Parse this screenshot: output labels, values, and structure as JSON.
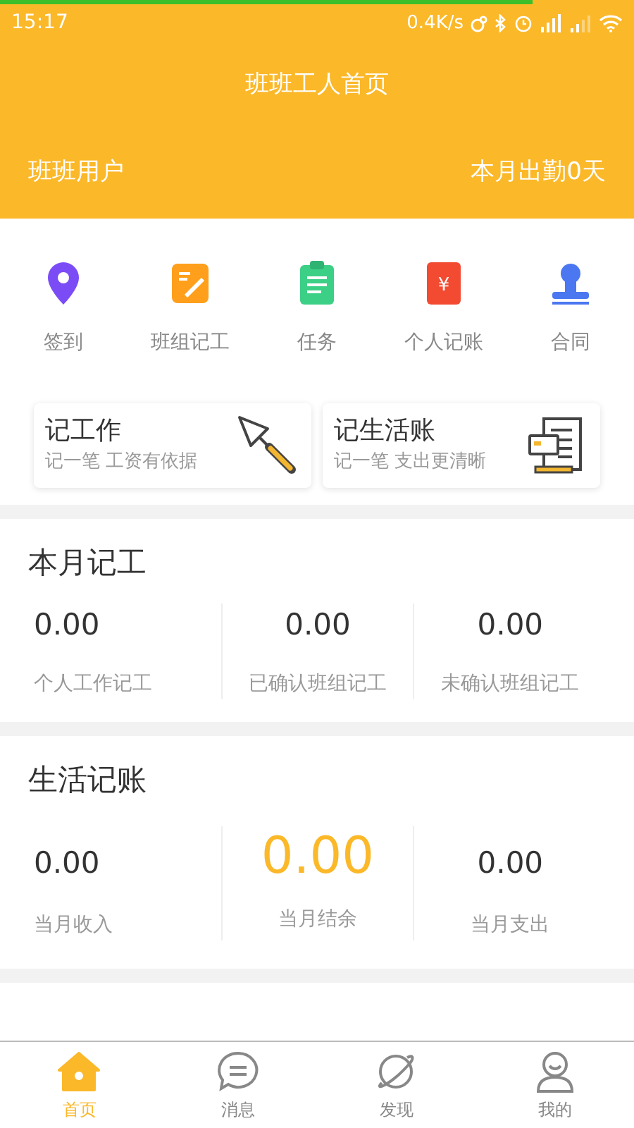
{
  "status_bar": {
    "time": "15:17",
    "speed": "0.4K/s",
    "load_bar": {
      "level": 0.84
    }
  },
  "header": {
    "title": "班班工人首页",
    "user": "班班用户",
    "attendance": "本月出勤0天"
  },
  "shortcuts": [
    {
      "kind": "pin",
      "label": "签到"
    },
    {
      "kind": "note",
      "label": "班组记工"
    },
    {
      "kind": "clipboard",
      "label": "任务"
    },
    {
      "kind": "ledger",
      "label": "个人记账",
      "glyph": "¥"
    },
    {
      "kind": "stamp",
      "label": "合同"
    }
  ],
  "cards": [
    {
      "kind": "trowel",
      "title": "记工作",
      "subtitle": "记一笔 工资有依据"
    },
    {
      "kind": "receipt",
      "title": "记生活账",
      "subtitle": "记一笔 支出更清晰"
    }
  ],
  "work_section": {
    "title": "本月记工",
    "stats": [
      {
        "value": "0.00",
        "label": "个人工作记工",
        "highlight": false
      },
      {
        "value": "0.00",
        "label": "已确认班组记工",
        "highlight": false
      },
      {
        "value": "0.00",
        "label": "未确认班组记工",
        "highlight": false
      }
    ]
  },
  "life_section": {
    "title": "生活记账",
    "stats": [
      {
        "value": "0.00",
        "label": "当月收入",
        "highlight": false
      },
      {
        "value": "0.00",
        "label": "当月结余",
        "highlight": true
      },
      {
        "value": "0.00",
        "label": "当月支出",
        "highlight": false
      }
    ]
  },
  "nav": [
    {
      "kind": "home",
      "label": "首页",
      "selected": true
    },
    {
      "kind": "chat",
      "label": "消息",
      "selected": false
    },
    {
      "kind": "planet",
      "label": "发现",
      "selected": false
    },
    {
      "kind": "person",
      "label": "我的",
      "selected": false
    }
  ]
}
